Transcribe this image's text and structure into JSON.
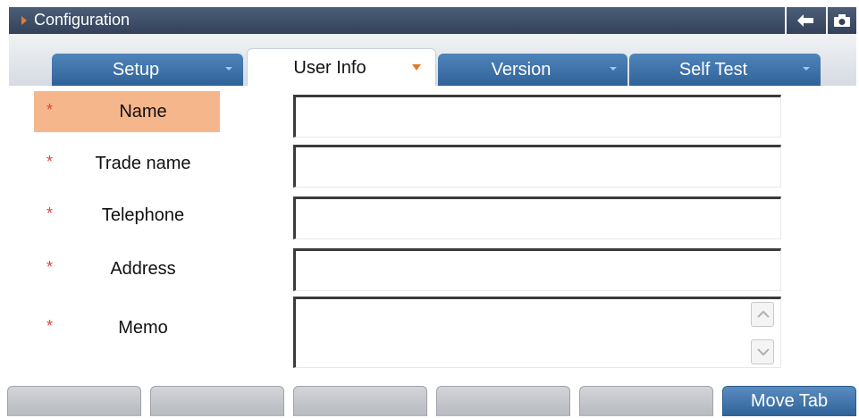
{
  "window": {
    "title": "Configuration",
    "back_icon": "arrow-left-icon",
    "screenshot_icon": "camera-icon"
  },
  "tabs": [
    {
      "label": "Setup",
      "active": false
    },
    {
      "label": "User Info",
      "active": true
    },
    {
      "label": "Version",
      "active": false
    },
    {
      "label": "Self Test",
      "active": false
    }
  ],
  "form": {
    "required_mark": "*",
    "fields": [
      {
        "label": "Name",
        "value": ""
      },
      {
        "label": "Trade name",
        "value": ""
      },
      {
        "label": "Telephone",
        "value": ""
      },
      {
        "label": "Address",
        "value": ""
      },
      {
        "label": "Memo",
        "value": ""
      }
    ]
  },
  "footer": {
    "move_tab_label": "Move Tab"
  },
  "colors": {
    "title_bar": "#3b4a62",
    "tab_blue": "#3a70a8",
    "selected_label": "#f6b68c",
    "required_star": "#e0453a",
    "accent_orange": "#e07a2c"
  }
}
